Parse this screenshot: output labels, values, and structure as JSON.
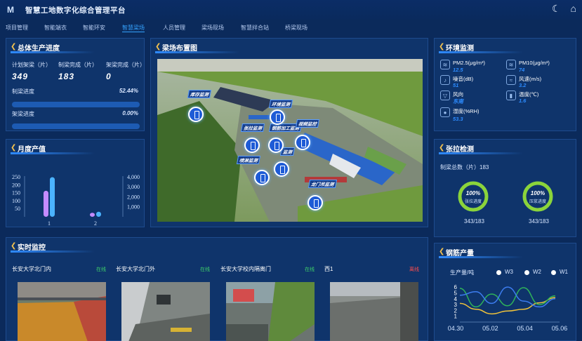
{
  "app": {
    "title": "智慧工地数字化综合管理平台",
    "logo": "M"
  },
  "icons": {
    "theme": "moon-icon",
    "home": "home-icon"
  },
  "nav": {
    "tabs": [
      "项目管理",
      "智能端衣",
      "智能环安",
      "智慧梁场",
      "人员管理",
      "梁场现场",
      "智慧拌合站",
      "桥梁现场"
    ],
    "active_index": 3
  },
  "progress": {
    "title": "总体生产进度",
    "planned_label": "计划架梁（片）",
    "planned_value": "349",
    "made_label": "制梁完成（片）",
    "made_value": "183",
    "erected_label": "架梁完成（片）",
    "erected_value": "0",
    "make_progress_label": "制梁进度",
    "make_progress_value": "52.44%",
    "make_progress_pct": 52.44,
    "erect_progress_label": "架梁进度",
    "erect_progress_value": "0.00%",
    "erect_progress_pct": 0
  },
  "monthly": {
    "title": "月度产值"
  },
  "chart_data": {
    "type": "bar",
    "categories": [
      "1",
      "2"
    ],
    "series": [
      {
        "values": [
          160,
          25
        ],
        "color": "#c48bff"
      },
      {
        "values": [
          3900,
          500
        ],
        "color": "#4bb3ff"
      }
    ],
    "y_left_ticks": [
      "250",
      "200",
      "150",
      "100",
      "50"
    ],
    "y_right_ticks": [
      "4,000",
      "3,000",
      "2,000",
      "1,000"
    ],
    "ylim_left": [
      0,
      250
    ],
    "ylim_right": [
      0,
      4000
    ]
  },
  "map": {
    "title": "梁场布置图",
    "tags": [
      "库存监测",
      "环境监测",
      "张拉监测",
      "钢筋加工监测",
      "视频监控",
      "监测",
      "喷淋监测",
      "龙门吊监测"
    ]
  },
  "env": {
    "title": "环境监测",
    "items": [
      {
        "label": "PM2.5(μg/m³)",
        "value": "12.5",
        "icon": "dust-icon"
      },
      {
        "label": "PM10(μg/m³)",
        "value": "74",
        "icon": "dust-icon"
      },
      {
        "label": "噪音(dB)",
        "value": "51",
        "icon": "noise-icon"
      },
      {
        "label": "风速(m/s)",
        "value": "3.2",
        "icon": "wind-speed-icon"
      },
      {
        "label": "风向",
        "value": "东南",
        "icon": "wind-direction-icon"
      },
      {
        "label": "温度(℃)",
        "value": "1.6",
        "icon": "thermometer-icon"
      },
      {
        "label": "湿度(%RH)",
        "value": "53.3",
        "icon": "humidity-icon"
      }
    ]
  },
  "tension": {
    "title": "张拉检测",
    "total_label": "制梁总数（片）183",
    "rings": [
      {
        "pct": "100%",
        "label": "张拉进度",
        "count": "343/183",
        "fraction": 1.0
      },
      {
        "pct": "100%",
        "label": "压浆进度",
        "count": "343/183",
        "fraction": 1.0
      }
    ]
  },
  "monitor": {
    "title": "实时监控",
    "cams": [
      {
        "name": "长安大学北门内",
        "status": "在线",
        "status_color": "#3ed06a"
      },
      {
        "name": "长安大学北门外",
        "status": "在线",
        "status_color": "#3ed06a"
      },
      {
        "name": "长安大学校内隔离门",
        "status": "在线",
        "status_color": "#3ed06a"
      },
      {
        "name": "西1",
        "status": "离线",
        "status_color": "#ff4d4d"
      }
    ]
  },
  "steel": {
    "title": "钢筋产量",
    "ylabel": "生产量/吨",
    "legend": [
      "W3",
      "W2",
      "W1"
    ],
    "x_ticks": [
      "04.30",
      "05.02",
      "05.04",
      "05.06"
    ],
    "y_ticks": [
      "6",
      "5",
      "4",
      "3",
      "2",
      "1"
    ]
  },
  "line_chart": {
    "type": "line",
    "x": [
      "04.30",
      "05.01",
      "05.02",
      "05.03",
      "05.04",
      "05.05",
      "05.06"
    ],
    "series": [
      {
        "name": "W3",
        "color": "#f0c33a",
        "values": [
          3.2,
          2.2,
          1.4,
          1.9,
          2.2,
          3.3,
          4.2
        ]
      },
      {
        "name": "W2",
        "color": "#2fb35a",
        "values": [
          5.8,
          2.6,
          4.8,
          2.8,
          5.9,
          3.0,
          4.5
        ]
      },
      {
        "name": "W1",
        "color": "#3d7df0",
        "values": [
          4.6,
          5.2,
          3.2,
          6.0,
          3.6,
          2.6,
          4.0
        ]
      }
    ],
    "ylim": [
      0,
      6.5
    ]
  }
}
